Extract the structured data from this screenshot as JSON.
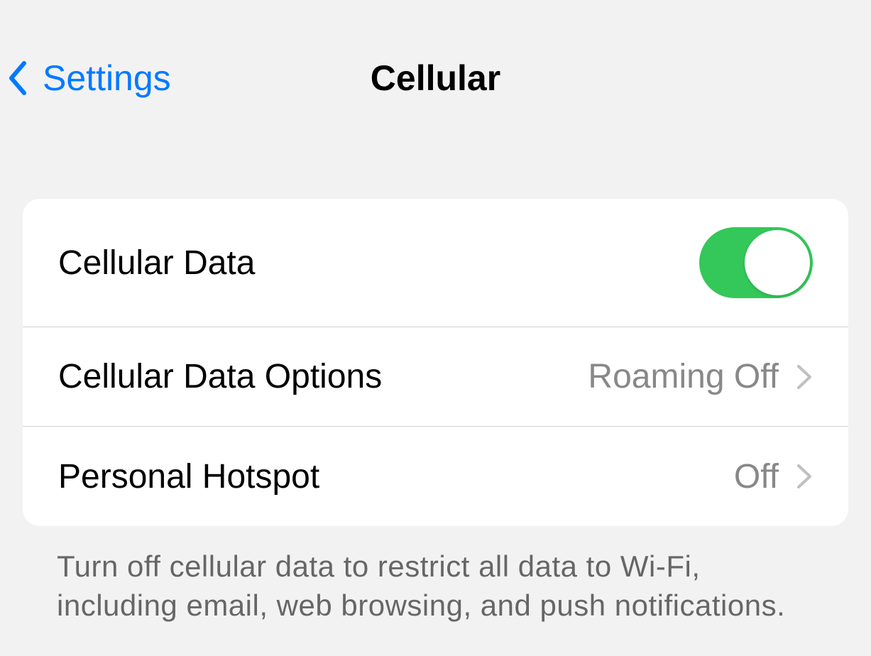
{
  "header": {
    "back_label": "Settings",
    "title": "Cellular"
  },
  "rows": {
    "cellular_data": {
      "label": "Cellular Data",
      "toggle_on": true
    },
    "cellular_data_options": {
      "label": "Cellular Data Options",
      "value": "Roaming Off"
    },
    "personal_hotspot": {
      "label": "Personal Hotspot",
      "value": "Off"
    }
  },
  "footer": {
    "text": "Turn off cellular data to restrict all data to Wi-Fi, including email, web browsing, and push notifications."
  },
  "colors": {
    "link_blue": "#007aff",
    "toggle_green": "#34c759",
    "separator": "#d1d1d1",
    "secondary_text": "#888",
    "footer_text": "#666",
    "background": "#f2f2f2"
  }
}
